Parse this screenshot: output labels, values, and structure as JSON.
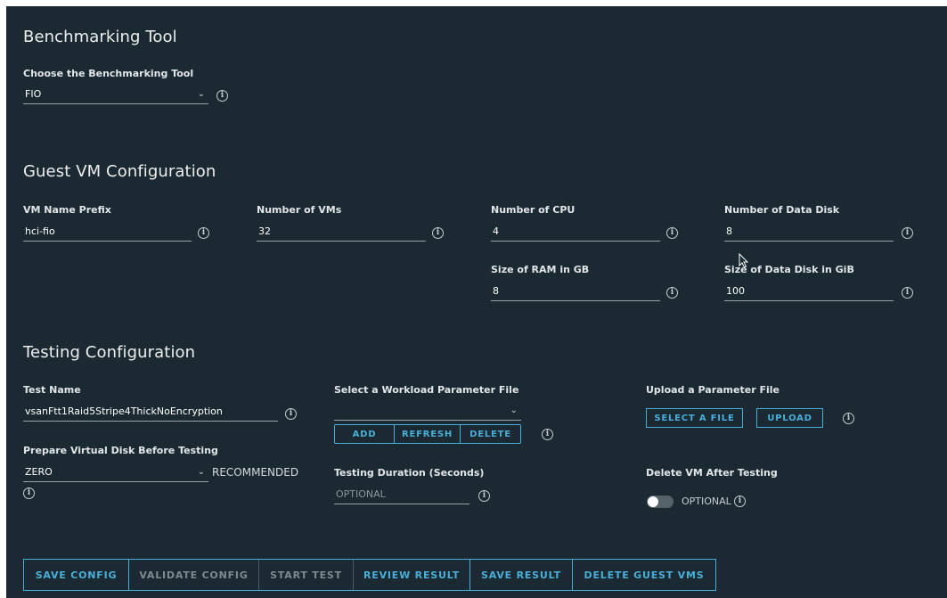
{
  "benchmark": {
    "title": "Benchmarking Tool",
    "tool_label": "Choose the Benchmarking Tool",
    "tool_value": "FIO"
  },
  "guest_vm": {
    "title": "Guest VM Configuration",
    "vm_name_prefix_label": "VM Name Prefix",
    "vm_name_prefix_value": "hci-fio",
    "num_vms_label": "Number of VMs",
    "num_vms_value": "32",
    "num_cpu_label": "Number of CPU",
    "num_cpu_value": "4",
    "num_data_disk_label": "Number of Data Disk",
    "num_data_disk_value": "8",
    "ram_label": "Size of RAM in GB",
    "ram_value": "8",
    "disk_size_label": "Size of Data Disk in GiB",
    "disk_size_value": "100"
  },
  "testing": {
    "title": "Testing Configuration",
    "test_name_label": "Test Name",
    "test_name_value": "vsanFtt1Raid5Stripe4ThickNoEncryption",
    "prepare_label": "Prepare Virtual Disk Before Testing",
    "prepare_value": "ZERO",
    "prepare_hint": "RECOMMENDED",
    "workload_label": "Select a Workload Parameter File",
    "workload_value": "",
    "add_label": "ADD",
    "refresh_label": "REFRESH",
    "delete_label": "DELETE",
    "duration_label": "Testing Duration (Seconds)",
    "duration_placeholder": "OPTIONAL",
    "upload_label": "Upload a Parameter File",
    "select_file_label": "SELECT A FILE",
    "upload_button_label": "UPLOAD",
    "delete_vm_label": "Delete VM After Testing",
    "delete_vm_hint": "OPTIONAL",
    "delete_vm_enabled": false
  },
  "actions": {
    "save_config": "SAVE CONFIG",
    "validate_config": "VALIDATE CONFIG",
    "start_test": "START TEST",
    "review_result": "REVIEW RESULT",
    "save_result": "SAVE RESULT",
    "delete_guest_vms": "DELETE GUEST VMS"
  },
  "icons": {
    "info": "info-icon",
    "chevron": "chevron-down-icon",
    "cursor": "mouse-cursor-icon"
  },
  "colors": {
    "background": "#1b2a32",
    "accent": "#49afd9",
    "disabled": "#7d8a90"
  }
}
